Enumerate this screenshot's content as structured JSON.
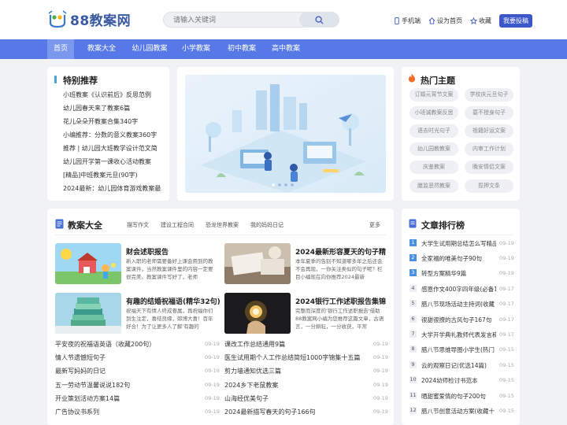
{
  "site": {
    "logo_text": "88教案网",
    "search_placeholder": "请输入关键词",
    "top_links": {
      "mobile": "手机端",
      "homepage": "设为首页",
      "favorite": "收藏",
      "submit": "我要投稿"
    }
  },
  "nav": [
    "首页",
    "教案大全",
    "幼儿园教案",
    "小学教案",
    "初中教案",
    "高中教案"
  ],
  "featured": {
    "title": "特别推荐",
    "items": [
      "小班教案《认识前后》反思范例",
      "幼儿园春天来了教案6篇",
      "花儿朵朵开教案合集340字",
      "小编推荐：分数的意义教案360字",
      "推荐 | 幼儿园大班教学设计范文简",
      "幼儿园开学第一课收心活动教案",
      "[精品]中班教案元旦(90字)",
      "2024最新：幼儿园体育游戏教案最"
    ]
  },
  "hot": {
    "title": "热门主题",
    "tags": [
      "订婚元宵节文案",
      "学校庆元旦句子",
      "小班诚教案反思",
      "耍不授身句子",
      "语去时光句子",
      "祖籍好运文案",
      "幼儿园教教案",
      "内审工作计划",
      "庆鉴教案",
      "晚安情侣文案",
      "膳监恶然教案",
      "揽押文条"
    ]
  },
  "plans": {
    "title": "教案大全",
    "tabs": [
      "描写作文",
      "建设工程合同",
      "恐龙世界教案",
      "我的妈妈日记"
    ],
    "more": "更多",
    "cards": [
      {
        "title": "财会述职报告",
        "desc": "新入职的老师需要备好上课会用到的教案课件，当然教案课件里的内容一定要很完美。教案课件写好了，老师"
      },
      {
        "title": "2024最新形容夏天的句子精",
        "desc": "本年夏季的告别不知道哪多年之后还会不会再现，一你关注类似的句子呢？栏目小编现在向你推荐2024最新"
      },
      {
        "title": "有趣的结婚祝福语(精华32句)",
        "desc": "祝福天下有情人终成眷属，再祝福你们到生注定，喜结良缘，郎博大喜！百年好合！为了让更多人了解'有趣的"
      },
      {
        "title": "2024银行工作述职报告集锦",
        "desc": "完整而深度的'银行工作述职报告'借助88教案网小编为您推荐这篇文章，古语言，一分耕耘，一分收获，平常"
      }
    ],
    "left_rows": [
      {
        "text": "平安夜的祝福语英语（收藏200句）",
        "date": "09-19"
      },
      {
        "text": "情人节遗憾短句子",
        "date": "09-19"
      },
      {
        "text": "最新写妈妈的日记",
        "date": "09-19"
      },
      {
        "text": "五一劳动节温馨说说182句",
        "date": "09-19"
      },
      {
        "text": "开业策划活动方案14篇",
        "date": "09-19"
      },
      {
        "text": "广告协议书系列",
        "date": "09-19"
      }
    ],
    "right_rows": [
      {
        "text": "课改工作总结通用9篇",
        "date": "09-19"
      },
      {
        "text": "医生试用期个人工作总结简短1000字锦集十五篇",
        "date": "09-19"
      },
      {
        "text": "剪力墙通知优选三篇",
        "date": "09-19"
      },
      {
        "text": "2024乡下老鼠教案",
        "date": "09-19"
      },
      {
        "text": "山海经优美句子",
        "date": "09-19"
      },
      {
        "text": "2024最新描写春天的句子166句",
        "date": "09-19"
      }
    ]
  },
  "ranking": {
    "title": "文章排行榜",
    "items": [
      {
        "num": "1",
        "text": "大学生试用期总结怎么写精品",
        "date": "09-19"
      },
      {
        "num": "2",
        "text": "全家福的唯美句子90句",
        "date": "09-19"
      },
      {
        "num": "3",
        "text": "转型方案精华9篇",
        "date": "09-19"
      },
      {
        "num": "4",
        "text": "感恩作文400字四年级(必备1",
        "date": "09-17"
      },
      {
        "num": "5",
        "text": "腊八节现场活动主持词(收藏",
        "date": "09-17"
      },
      {
        "num": "6",
        "text": "很甜很撩的古风句子167句",
        "date": "09-17"
      },
      {
        "num": "7",
        "text": "大学开学典礼教师代表发言稿",
        "date": "09-17"
      },
      {
        "num": "8",
        "text": "腊八节思维导图小学生(热门",
        "date": "09-15"
      },
      {
        "num": "9",
        "text": "云的观察日记(优选14篇)",
        "date": "09-15"
      },
      {
        "num": "10",
        "text": "2024幼师检讨书范本",
        "date": "09-15"
      },
      {
        "num": "11",
        "text": "晒甜蜜爱情的句子200句",
        "date": "09-15"
      },
      {
        "num": "12",
        "text": "腊八节创意活动方案(收藏十",
        "date": "09-15"
      }
    ]
  },
  "colors": {
    "nav": "#5779e8",
    "nav_active": "#7b98ef",
    "submit": "#3c57c9",
    "accent_blue": "#4a90e2",
    "fire": "#f26b2a"
  }
}
